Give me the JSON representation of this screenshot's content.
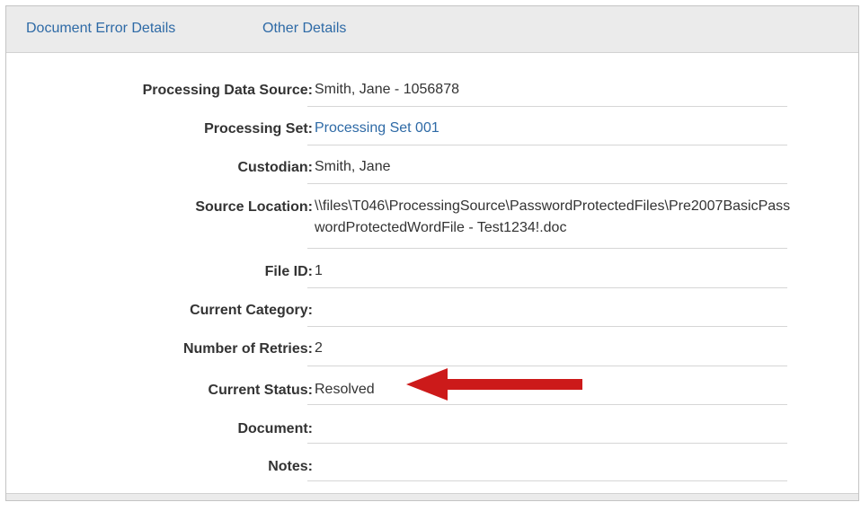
{
  "tabs": {
    "document_error_details": "Document Error Details",
    "other_details": "Other Details"
  },
  "fields": {
    "processing_data_source": {
      "label": "Processing Data Source:",
      "value": "Smith, Jane - 1056878"
    },
    "processing_set": {
      "label": "Processing Set:",
      "value": "Processing Set 001"
    },
    "custodian": {
      "label": "Custodian:",
      "value": "Smith, Jane"
    },
    "source_location": {
      "label": "Source Location:",
      "value": "\\\\files\\T046\\ProcessingSource\\PasswordProtectedFiles\\Pre2007BasicPasswordProtectedWordFile  - Test1234!.doc"
    },
    "file_id": {
      "label": "File ID:",
      "value": "1"
    },
    "current_category": {
      "label": "Current Category:",
      "value": ""
    },
    "number_of_retries": {
      "label": "Number of Retries:",
      "value": "2"
    },
    "current_status": {
      "label": "Current Status:",
      "value": "Resolved"
    },
    "document": {
      "label": "Document:",
      "value": ""
    },
    "notes": {
      "label": "Notes:",
      "value": ""
    }
  },
  "colors": {
    "link": "#2e6aa6",
    "text": "#333333",
    "tabbar_bg": "#ebebeb",
    "annotation_arrow": "#cc1a1a"
  },
  "icons": {
    "annotation": "red-arrow-pointing-left"
  }
}
